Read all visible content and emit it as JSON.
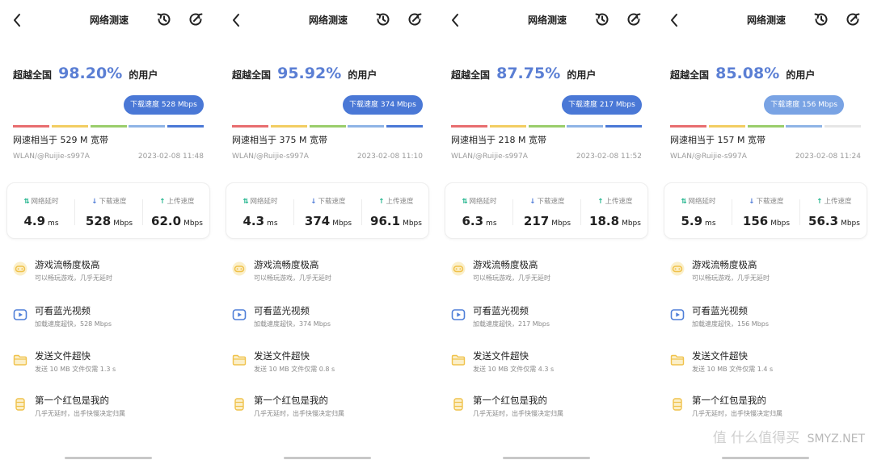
{
  "colors": {
    "accent_blue": "#4a78d6",
    "percent_text": "#5b7fd4",
    "tooltip_bg": "#4a78d6",
    "tooltip_bg_alt": "#79a3e4",
    "bar_red": "#e86d6f",
    "bar_yellow": "#f2cd62",
    "bar_green": "#9acd6b",
    "bar_lightblue": "#8fb4e6",
    "bar_blue": "#4a78d6",
    "bar_grey": "#e6e6e6",
    "feature_icon_bg": "#fbefc9",
    "feature_icon_yellow": "#f0c24b",
    "feature_icon_blue": "#4f7fd8"
  },
  "icons": {
    "back": "chevron-left-icon",
    "history": "history-icon",
    "retest": "refresh-icon",
    "latency": "latency-icon",
    "download": "download-arrow-icon",
    "upload": "upload-arrow-icon",
    "game": "gamepad-icon",
    "video": "play-icon",
    "file": "folder-icon",
    "redpacket": "cup-icon"
  },
  "common": {
    "title": "网络测速",
    "percent_prefix": "超越全国",
    "percent_suffix": "的用户",
    "network": "WLAN/@Ruijie-s997A",
    "latency_label": "网络延时",
    "download_label": "下载速度",
    "upload_label": "上传速度",
    "latency_unit": "ms",
    "speed_unit": "Mbps",
    "latency_icon_glyph": "⇅",
    "download_icon_glyph": "↓",
    "upload_icon_glyph": "↑",
    "game_title": "游戏流畅度极高",
    "game_desc": "可以畅玩游戏，几乎无延时",
    "video_title": "可看蓝光视频",
    "file_title": "发送文件超快",
    "redpacket_title": "第一个红包是我的",
    "redpacket_desc": "几乎无延时，出手快慢决定归属"
  },
  "panels": [
    {
      "percent": "98.20%",
      "tooltip": "下载速度 528 Mbps",
      "level_segment": 5,
      "equiv": "网速相当于 529 M 宽带",
      "time": "2023-02-08 11:48",
      "latency": "4.9",
      "download": "528",
      "upload": "62.0",
      "video_desc": "加载速度超快，528 Mbps",
      "file_desc": "发送 10 MB 文件仅需 1.3 s"
    },
    {
      "percent": "95.92%",
      "tooltip": "下载速度 374 Mbps",
      "level_segment": 5,
      "equiv": "网速相当于 375 M 宽带",
      "time": "2023-02-08 11:10",
      "latency": "4.3",
      "download": "374",
      "upload": "96.1",
      "video_desc": "加载速度超快，374 Mbps",
      "file_desc": "发送 10 MB 文件仅需 0.8 s"
    },
    {
      "percent": "87.75%",
      "tooltip": "下载速度 217 Mbps",
      "level_segment": 5,
      "equiv": "网速相当于 218 M 宽带",
      "time": "2023-02-08 11:52",
      "latency": "6.3",
      "download": "217",
      "upload": "18.8",
      "video_desc": "加载速度超快，217 Mbps",
      "file_desc": "发送 10 MB 文件仅需 4.3 s"
    },
    {
      "percent": "85.08%",
      "tooltip": "下载速度 156 Mbps",
      "level_segment": 4,
      "equiv": "网速相当于 157 M 宽带",
      "time": "2023-02-08 11:24",
      "latency": "5.9",
      "download": "156",
      "upload": "56.3",
      "video_desc": "加载速度超快，156 Mbps",
      "file_desc": "发送 10 MB 文件仅需 1.4 s"
    }
  ],
  "watermark": {
    "glyph": "值",
    "text": "什么值得买",
    "site": "SMYZ.NET"
  }
}
